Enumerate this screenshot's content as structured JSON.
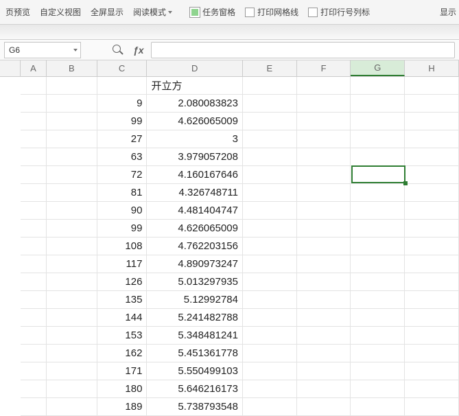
{
  "toolbar": {
    "btn_preview": "页预览",
    "btn_customview": "自定义视图",
    "btn_fullscreen": "全屏显示",
    "btn_readmode": "阅读模式",
    "chk_taskpane": "任务窗格",
    "chk_gridlines": "打印网格线",
    "chk_rowcolhead": "打印行号列标",
    "btn_display": "显示"
  },
  "namebox": {
    "value": "G6"
  },
  "formula": {
    "value": ""
  },
  "columns": [
    "A",
    "B",
    "C",
    "D",
    "E",
    "F",
    "G",
    "H"
  ],
  "sheet": {
    "header_d": "开立方",
    "rows": [
      {
        "c": "9",
        "d": "2.080083823"
      },
      {
        "c": "99",
        "d": "4.626065009"
      },
      {
        "c": "27",
        "d": "3"
      },
      {
        "c": "63",
        "d": "3.979057208"
      },
      {
        "c": "72",
        "d": "4.160167646"
      },
      {
        "c": "81",
        "d": "4.326748711"
      },
      {
        "c": "90",
        "d": "4.481404747"
      },
      {
        "c": "99",
        "d": "4.626065009"
      },
      {
        "c": "108",
        "d": "4.762203156"
      },
      {
        "c": "117",
        "d": "4.890973247"
      },
      {
        "c": "126",
        "d": "5.013297935"
      },
      {
        "c": "135",
        "d": "5.12992784"
      },
      {
        "c": "144",
        "d": "5.241482788"
      },
      {
        "c": "153",
        "d": "5.348481241"
      },
      {
        "c": "162",
        "d": "5.451361778"
      },
      {
        "c": "171",
        "d": "5.550499103"
      },
      {
        "c": "180",
        "d": "5.646216173"
      },
      {
        "c": "189",
        "d": "5.738793548"
      }
    ]
  },
  "selection": {
    "cell": "G6",
    "col_index": 6,
    "row_index": 6
  }
}
